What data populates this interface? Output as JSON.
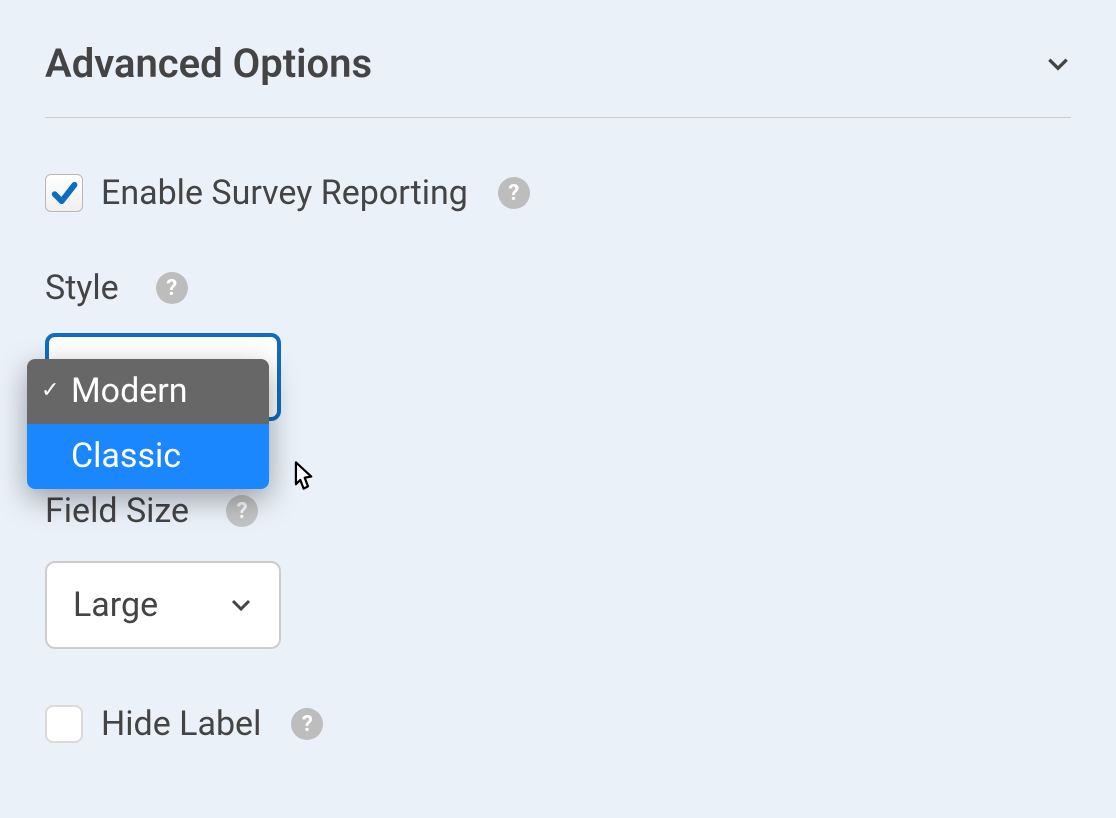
{
  "header": {
    "title": "Advanced Options"
  },
  "survey": {
    "label": "Enable Survey Reporting",
    "help": "?",
    "checked": true
  },
  "style": {
    "label": "Style",
    "help": "?",
    "options": [
      "Modern",
      "Classic"
    ],
    "selected": "Modern",
    "highlighted": "Classic"
  },
  "fieldSize": {
    "label": "Field Size",
    "help": "?",
    "value": "Large"
  },
  "hideLabel": {
    "label": "Hide Label",
    "help": "?",
    "checked": false
  }
}
